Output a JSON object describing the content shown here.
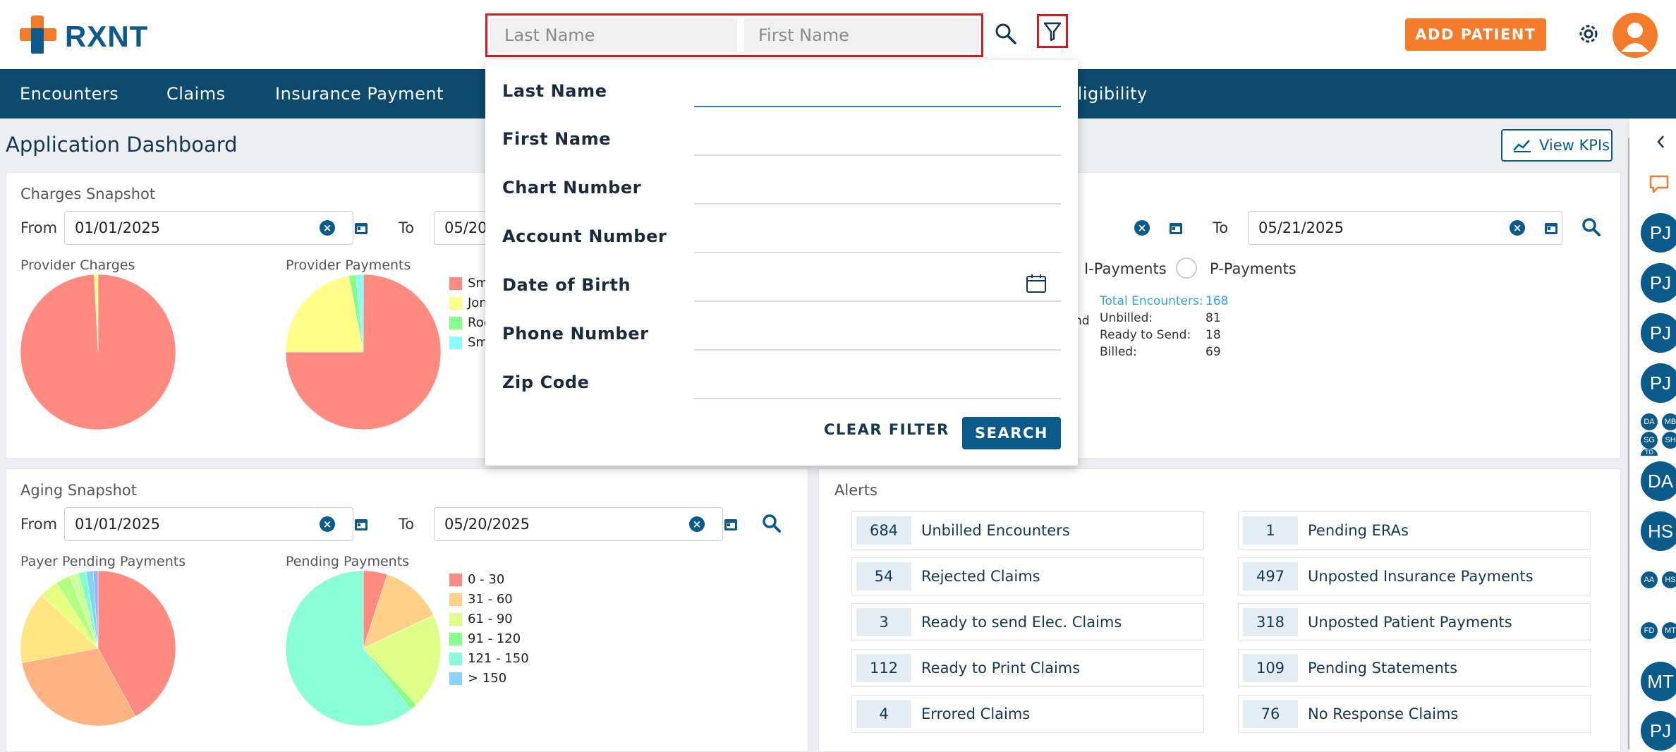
{
  "header": {
    "logo_text": "RXNT",
    "search_last_placeholder": "Last Name",
    "search_first_placeholder": "First Name",
    "add_patient_label": "ADD PATIENT"
  },
  "nav": {
    "items": [
      "Encounters",
      "Claims",
      "Insurance Payment",
      "Eligibility"
    ]
  },
  "page": {
    "title": "Application Dashboard",
    "view_kpis": "View KPIs"
  },
  "charges_snapshot": {
    "title": "Charges Snapshot",
    "from_label": "From",
    "from_value": "01/01/2025",
    "to_label": "To",
    "to_value": "05/20",
    "provider_charges_title": "Provider Charges",
    "provider_payments_title": "Provider Payments",
    "legend": [
      "Sm",
      "Jon",
      "Roc",
      "Sm"
    ]
  },
  "encounter_snapshot": {
    "to_label": "To",
    "to_value": "05/21/2025",
    "radio_i": "I-Payments",
    "radio_p": "P-Payments",
    "partial_label": "nd",
    "stats": [
      {
        "label": "Total Encounters:",
        "value": "168"
      },
      {
        "label": "Unbilled:",
        "value": "81"
      },
      {
        "label": "Ready to Send:",
        "value": "18"
      },
      {
        "label": "Billed:",
        "value": "69"
      }
    ]
  },
  "aging_snapshot": {
    "title": "Aging Snapshot",
    "from_label": "From",
    "from_value": "01/01/2025",
    "to_label": "To",
    "to_value": "05/20/2025",
    "payer_pending_title": "Payer Pending Payments",
    "pending_title": "Pending Payments",
    "legend": [
      "0 - 30",
      "31 - 60",
      "61 - 90",
      "91 - 120",
      "121 - 150",
      "> 150"
    ]
  },
  "alerts": {
    "title": "Alerts",
    "left": [
      {
        "count": "684",
        "label": "Unbilled Encounters"
      },
      {
        "count": "54",
        "label": "Rejected Claims"
      },
      {
        "count": "3",
        "label": "Ready to send Elec. Claims"
      },
      {
        "count": "112",
        "label": "Ready to Print Claims"
      },
      {
        "count": "4",
        "label": "Errored Claims"
      }
    ],
    "right": [
      {
        "count": "1",
        "label": "Pending ERAs"
      },
      {
        "count": "497",
        "label": "Unposted Insurance Payments"
      },
      {
        "count": "318",
        "label": "Unposted Patient Payments"
      },
      {
        "count": "109",
        "label": "Pending Statements"
      },
      {
        "count": "76",
        "label": "No Response Claims"
      }
    ]
  },
  "filter_panel": {
    "fields": [
      "Last Name",
      "First Name",
      "Chart Number",
      "Account Number",
      "Date of Birth",
      "Phone Number",
      "Zip Code"
    ],
    "clear_label": "CLEAR FILTER",
    "search_label": "SEARCH"
  },
  "right_rail": {
    "avatars": [
      "PJ",
      "PJ",
      "PJ",
      "PJ",
      "DA",
      "HS",
      "MT",
      "PJ"
    ],
    "small_avatars": [
      "DA",
      "MB",
      "SG",
      "SH",
      "TD",
      "AA",
      "HS",
      "FD",
      "MT"
    ]
  },
  "colors": {
    "brand_orange": "#f47b2a",
    "brand_blue": "#0a5a8c",
    "nav_bg": "#0c4a6e",
    "highlight_red": "#d71920"
  },
  "chart_data": [
    {
      "type": "pie",
      "title": "Provider Charges",
      "categories": [
        "Sm",
        "Jon"
      ],
      "values": [
        99.2,
        0.8
      ],
      "colors": [
        "#ff8a80",
        "#ffff88"
      ]
    },
    {
      "type": "pie",
      "title": "Provider Payments",
      "categories": [
        "Sm",
        "Jon",
        "Roc",
        "Sm"
      ],
      "values": [
        75,
        22,
        1.5,
        1.5
      ],
      "colors": [
        "#ff8a80",
        "#ffff88",
        "#88ff88",
        "#88ffff"
      ]
    },
    {
      "type": "pie",
      "title": "Payer Pending Payments",
      "values": [
        42,
        30,
        15,
        4,
        3,
        2,
        1.5,
        1.5,
        1
      ],
      "colors": [
        "#ff8a80",
        "#ffb380",
        "#ffe680",
        "#e6ff80",
        "#b3ff80",
        "#ccff99",
        "#80ffcc",
        "#80d4ff",
        "#99b3ff"
      ]
    },
    {
      "type": "pie",
      "title": "Pending Payments",
      "categories": [
        "0 - 30",
        "31 - 60",
        "61 - 90",
        "91 - 120",
        "121 - 150",
        "> 150"
      ],
      "values": [
        5,
        13,
        20,
        1.5,
        60.5,
        0
      ],
      "colors": [
        "#ff8a80",
        "#ffd088",
        "#ddff88",
        "#88ff88",
        "#88ffd6",
        "#88d4ff"
      ]
    }
  ]
}
